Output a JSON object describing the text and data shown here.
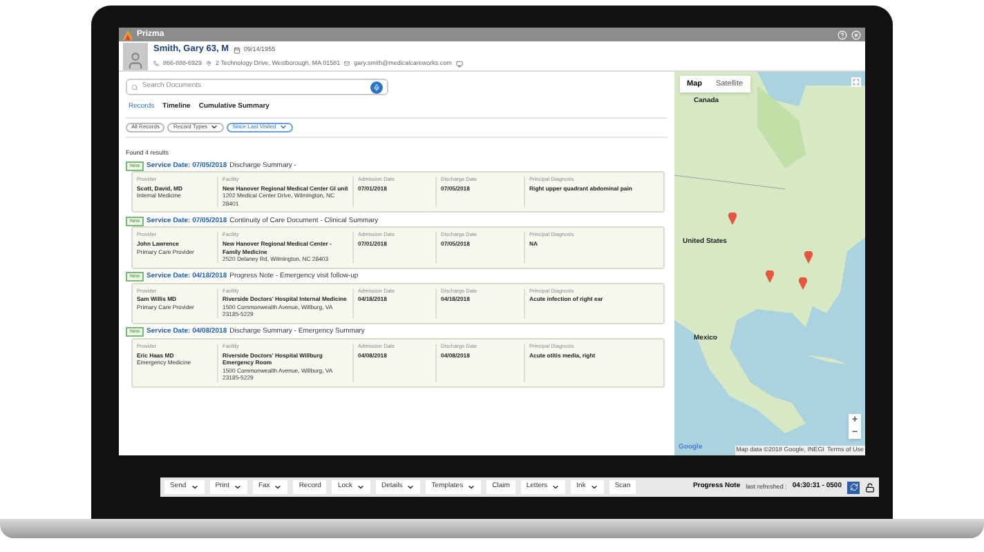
{
  "window": {
    "title": "Prizma"
  },
  "patient": {
    "name": "Smith, Gary  63, M",
    "dob": "09/14/1955",
    "phone": "866-888-6929",
    "address": "2 Technology Drive, Westborough, MA 01581",
    "email": "gary.smith@medicalcareworks.com"
  },
  "search": {
    "placeholder": "Search Documents"
  },
  "tabs": [
    {
      "label": "Records",
      "selected": true
    },
    {
      "label": "Timeline",
      "selected": false
    },
    {
      "label": "Cumulative Summary",
      "selected": false
    }
  ],
  "filters": [
    {
      "label": "All Records",
      "dropdown": false,
      "selected": false
    },
    {
      "label": "Record Types",
      "dropdown": true,
      "selected": false
    },
    {
      "label": "Since Last Visited",
      "dropdown": true,
      "selected": true
    }
  ],
  "results_count": "Found 4 results",
  "records": [
    {
      "badge": "New",
      "service_date": "Service Date: 07/05/2018",
      "title": "Discharge Summary -",
      "fields": [
        {
          "label": "Provider",
          "value": "Scott, David, MD",
          "detail": "Internal Medicine"
        },
        {
          "label": "Facility",
          "value": "New Hanover Regional Medical Center GI unit",
          "detail": "1202 Medical Center Drive, Wilmington, NC 28401"
        },
        {
          "label": "Admission Date",
          "value": "07/01/2018"
        },
        {
          "label": "Discharge Date",
          "value": "07/05/2018"
        },
        {
          "label": "Principal Diagnosis",
          "value": "Right upper quadrant abdominal pain"
        }
      ]
    },
    {
      "badge": "New",
      "service_date": "Service Date: 07/05/2018",
      "title": "Continuity of Care Document - Clinical Summary",
      "fields": [
        {
          "label": "Provider",
          "value": "John Lawrence",
          "detail": "Primary Care Provider"
        },
        {
          "label": "Facility",
          "value": "New Hanover Regional Medical Center - Family Medicine",
          "detail": "2520 Delaney Rd, Wilmington, NC 28403"
        },
        {
          "label": "Admission Date",
          "value": "07/01/2018"
        },
        {
          "label": "Discharge Date",
          "value": "07/05/2018"
        },
        {
          "label": "Principal Diagnosis",
          "value": "NA"
        }
      ]
    },
    {
      "badge": "New",
      "service_date": "Service Date: 04/18/2018",
      "title": "Progress Note - Emergency visit follow-up",
      "fields": [
        {
          "label": "Provider",
          "value": "Sam Willis MD",
          "detail": "Primary Care Provider"
        },
        {
          "label": "Facility",
          "value": "Riverside Doctors' Hospital Internal Medicine",
          "detail": "1500 Commonwealth Avenue, Willburg, VA 23185-5229"
        },
        {
          "label": "Admission Date",
          "value": "04/18/2018"
        },
        {
          "label": "Discharge Date",
          "value": "04/18/2018"
        },
        {
          "label": "Principal Diagnosis",
          "value": "Acute infection of right ear"
        }
      ]
    },
    {
      "badge": "New",
      "service_date": "Service Date: 04/08/2018",
      "title": "Discharge Summary - Emergency Summary",
      "fields": [
        {
          "label": "Provider",
          "value": "Eric Haas MD",
          "detail": "Emergency Medicine"
        },
        {
          "label": "Facility",
          "value": "Riverside Doctors' Hospital Willburg Emergency Room",
          "detail": "1500 Commonwealth Avenue, Willburg, VA 23185-5229"
        },
        {
          "label": "Admission Date",
          "value": "04/08/2018"
        },
        {
          "label": "Discharge Date",
          "value": "04/08/2018"
        },
        {
          "label": "Principal Diagnosis",
          "value": "Acute otitis media, right"
        }
      ]
    }
  ],
  "map": {
    "tabs": [
      {
        "label": "Map",
        "selected": true
      },
      {
        "label": "Satellite",
        "selected": false
      }
    ],
    "labels": [
      "Canada",
      "United States",
      "Mexico"
    ],
    "zoom_in": "+",
    "zoom_out": "−",
    "logo": "Google",
    "attribution": "Map data ©2018 Google, INEGI",
    "terms": "Terms of Use"
  },
  "toolbar": {
    "buttons": [
      {
        "label": "Send",
        "dropdown": true
      },
      {
        "label": "Print",
        "dropdown": true
      },
      {
        "label": "Fax",
        "dropdown": true
      },
      {
        "label": "Record",
        "dropdown": false
      },
      {
        "label": "Lock",
        "dropdown": true
      },
      {
        "label": "Details",
        "dropdown": true
      },
      {
        "label": "Templates",
        "dropdown": true
      },
      {
        "label": "Claim",
        "dropdown": false
      },
      {
        "label": "Letters",
        "dropdown": true
      },
      {
        "label": "Ink",
        "dropdown": true
      },
      {
        "label": "Scan",
        "dropdown": false
      }
    ],
    "status_title": "Progress Note",
    "status_text": "last refreshed :",
    "status_time": "04:30:31 - 0500"
  }
}
